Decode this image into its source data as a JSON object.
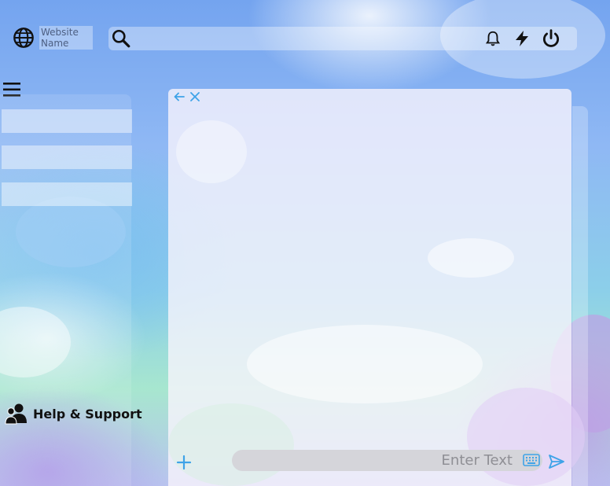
{
  "header": {
    "site_name": "Website\nName",
    "icons": [
      "globe-icon",
      "search-icon",
      "bell-icon",
      "lightning-icon",
      "power-icon"
    ]
  },
  "sidebar": {
    "menu_icon": "hamburger-icon",
    "items": [
      {
        "label": ""
      },
      {
        "label": ""
      },
      {
        "label": ""
      }
    ],
    "help_label": "Help & Support",
    "help_icon": "people-icon"
  },
  "chat": {
    "icons": [
      "back-arrow-icon",
      "close-icon",
      "plus-icon",
      "keyboard-icon",
      "send-icon"
    ],
    "input_placeholder": "Enter Text",
    "accent_color": "#3fa3e8"
  }
}
